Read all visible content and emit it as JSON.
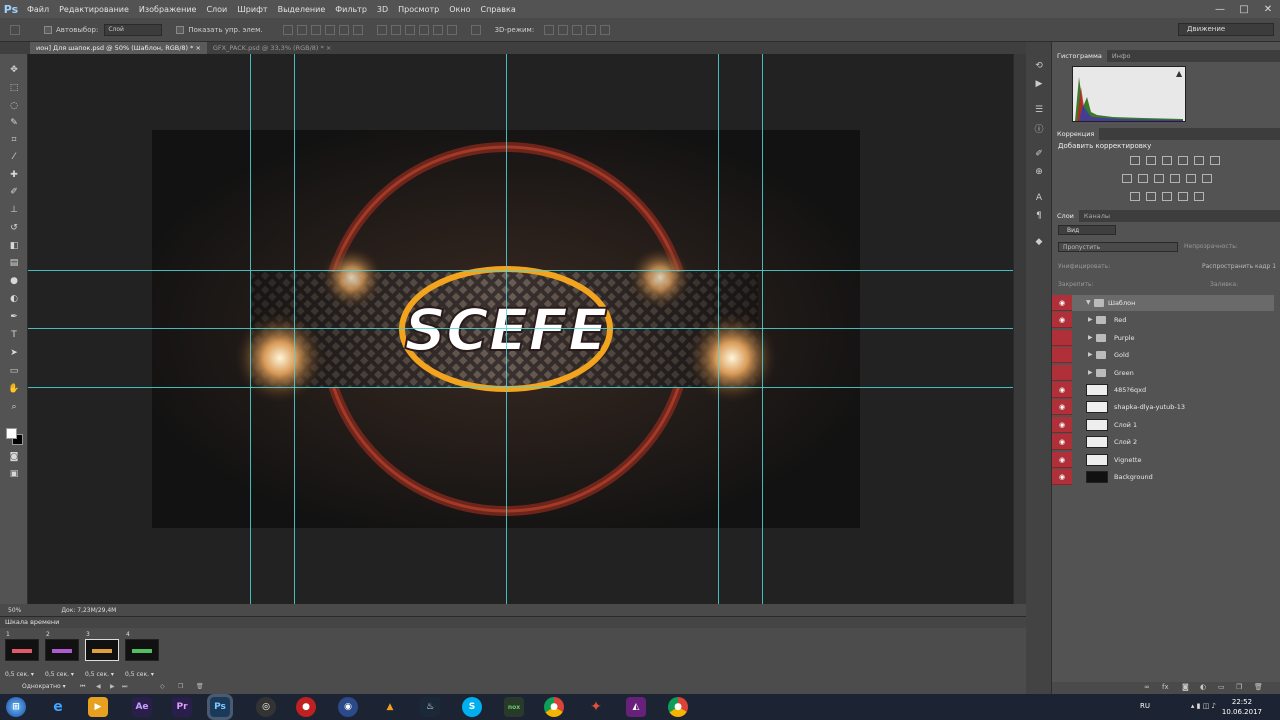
{
  "app": {
    "logo": "Ps"
  },
  "menu": [
    "Файл",
    "Редактирование",
    "Изображение",
    "Слои",
    "Шрифт",
    "Выделение",
    "Фильтр",
    "3D",
    "Просмотр",
    "Окно",
    "Справка"
  ],
  "window_buttons": [
    "—",
    "□",
    "✕"
  ],
  "options": {
    "autoselect_label": "Автовыбор:",
    "autoselect_value": "Слой",
    "show_controls_label": "Показать упр. элем.",
    "mode_3d": "3D-режим:",
    "workspace": "Движение"
  },
  "tabs": [
    {
      "label": "ион] Для шапок.psd @ 50% (Шаблон, RGB/8) * ×",
      "active": true
    },
    {
      "label": "GFX_PACK.psd @ 33,3% (RGB/8) * ×",
      "active": false
    }
  ],
  "artwork": {
    "title": "SCEFE"
  },
  "status": {
    "zoom": "50%",
    "doc": "Док: 7,23M/29,4M"
  },
  "timeline": {
    "title": "Шкала времени",
    "frames": [
      {
        "num": "1",
        "time": "0,5 сек. ▾",
        "glow": "#e05a6a"
      },
      {
        "num": "2",
        "time": "0,5 сек. ▾",
        "glow": "#b05ad0"
      },
      {
        "num": "3",
        "time": "0,5 сек. ▾",
        "glow": "#e0a040"
      },
      {
        "num": "4",
        "time": "0,5 сек. ▾",
        "glow": "#50c060"
      }
    ],
    "loop": "Однократно ▾"
  },
  "panels": {
    "top_tabs": [
      "Гистограмма",
      "Инфо"
    ],
    "corrections_tab": "Коррекция",
    "corrections_title": "Добавить корректировку",
    "layers_tabs": [
      "Слои",
      "Каналы"
    ],
    "filter_kind": "Вид",
    "blend": "Пропустить",
    "opacity_label": "Непрозрачность:",
    "unify_label": "Унифицировать:",
    "propagate_label": "Распространить кадр 1",
    "lock_label": "Закрепить:",
    "fill_label": "Заливка:",
    "layers": [
      {
        "name": "Шаблон",
        "type": "group-open",
        "eye": true
      },
      {
        "name": "Red",
        "type": "group",
        "eye": true
      },
      {
        "name": "Purple",
        "type": "group",
        "eye": false
      },
      {
        "name": "Gold",
        "type": "group",
        "eye": false
      },
      {
        "name": "Green",
        "type": "group",
        "eye": false
      },
      {
        "name": "485?6qxd",
        "type": "layer",
        "eye": true
      },
      {
        "name": "shapka-dlya-yutub-13",
        "type": "layer",
        "eye": true
      },
      {
        "name": "Слой 1",
        "type": "layer",
        "eye": true
      },
      {
        "name": "Слой 2",
        "type": "layer",
        "eye": true
      },
      {
        "name": "Vignette",
        "type": "layer",
        "eye": true
      },
      {
        "name": "Background",
        "type": "layer",
        "eye": true
      }
    ]
  },
  "taskbar": {
    "lang": "RU",
    "time": "22:52",
    "date": "10.06.2017"
  }
}
